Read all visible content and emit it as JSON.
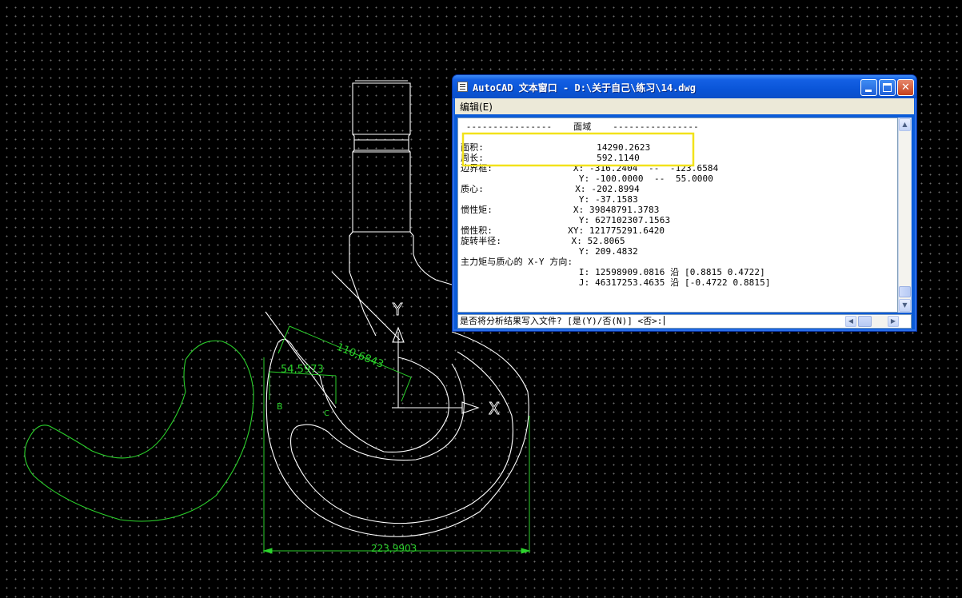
{
  "drawing": {
    "dim_width": "223,9903",
    "dim_angled": "110,6843",
    "dim_small": "54,5973",
    "point_b": "B",
    "point_c": "C",
    "ucs_x": "X",
    "ucs_y": "Y"
  },
  "text_window": {
    "title": "AutoCAD 文本窗口 - D:\\关于自己\\练习\\14.dwg",
    "menu_edit": "编辑(E)",
    "lines": [
      " ----------------    面域    ----------------",
      "",
      "面积:                     14290.2623",
      "周长:                     592.1140",
      "边界框:               X: -316.2404  --  -123.6584",
      "                      Y: -100.0000  --  55.0000",
      "质心:                 X: -202.8994",
      "                      Y: -37.1583",
      "惯性矩:               X: 39848791.3783",
      "                      Y: 627102307.1563",
      "惯性积:              XY: 121775291.6420",
      "旋转半径:             X: 52.8065",
      "                      Y: 209.4832",
      "主力矩与质心的 X-Y 方向:",
      "                      I: 12598909.0816 沿 [0.8815 0.4722]",
      "                      J: 46317253.4635 沿 [-0.4722 0.8815]"
    ],
    "prompt": "是否将分析结果写入文件? [是(Y)/否(N)] <否>:"
  },
  "colors": {
    "geometry": "#ffffff",
    "region": "#2bd12b",
    "highlight": "#f2e21a"
  }
}
